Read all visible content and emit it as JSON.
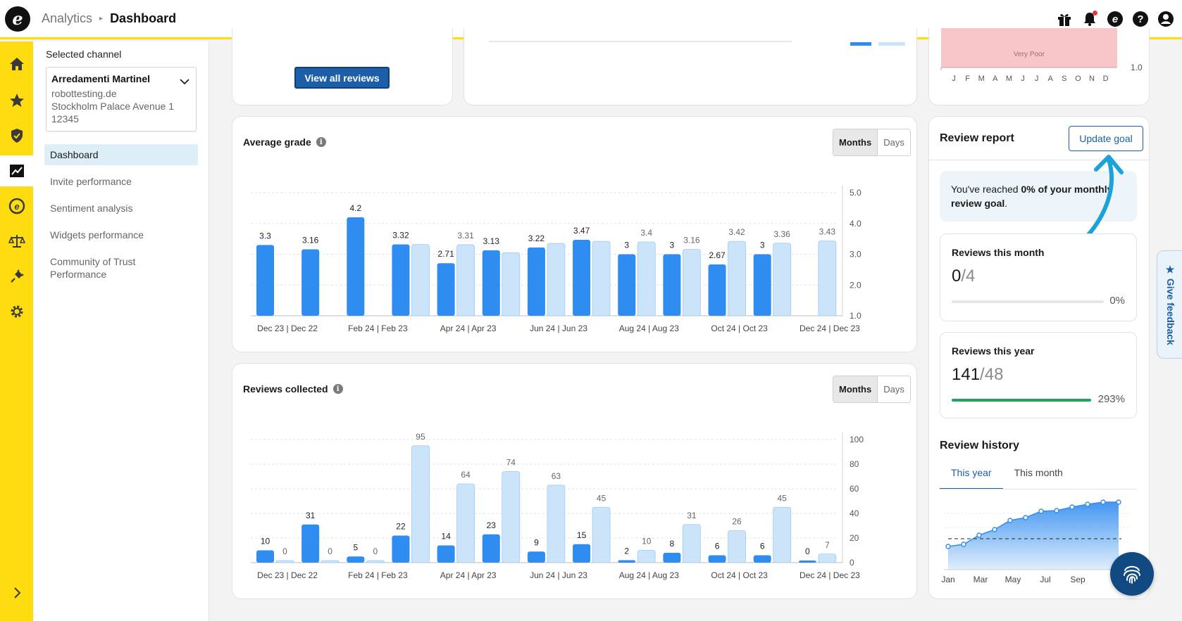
{
  "topbar": {
    "crumb_parent": "Analytics",
    "crumb_current": "Dashboard"
  },
  "rail": {
    "icons": [
      "home-icon",
      "star-icon",
      "shield-icon",
      "analytics-icon",
      "trustedshops-e-icon",
      "scales-icon",
      "plug-icon",
      "gear-icon"
    ],
    "active": "analytics-icon"
  },
  "sidebar": {
    "selected_label": "Selected channel",
    "channel": {
      "name": "Arredamenti Martinel",
      "domain": "robottesting.de",
      "address": "Stockholm Palace Avenue 1",
      "zip": "12345"
    },
    "nav": [
      "Dashboard",
      "Invite performance",
      "Sentiment analysis",
      "Widgets performance",
      "Community of Trust Performance"
    ]
  },
  "top_cards": {
    "view_all_reviews": "View all reviews",
    "very_poor": "Very Poor",
    "y_value": "1.0",
    "months": [
      "J",
      "F",
      "M",
      "A",
      "M",
      "J",
      "J",
      "A",
      "S",
      "O",
      "N",
      "D"
    ]
  },
  "average_grade": {
    "title": "Average grade",
    "toggle": [
      "Months",
      "Days"
    ],
    "chart_data": {
      "type": "bar",
      "ylim": [
        1.0,
        5.0
      ],
      "yticks": [
        "1.0",
        "2.0",
        "3.0",
        "4.0",
        "5.0"
      ],
      "x_labels": [
        "Dec 23 | Dec 22",
        "Feb 24 | Feb 23",
        "Apr 24 | Apr 23",
        "Jun 24 | Jun 23",
        "Aug 24 | Aug 23",
        "Oct 24 | Oct 23",
        "Dec 24 | Dec 23"
      ],
      "current": [
        3.3,
        3.16,
        4.2,
        3.32,
        2.71,
        3.13,
        3.22,
        3.47,
        3,
        3,
        2.67,
        3,
        null
      ],
      "previous": [
        null,
        null,
        null,
        null,
        3.31,
        null,
        null,
        null,
        3.4,
        3.16,
        3.42,
        3.36,
        3.43
      ],
      "previous_unlabeled": [
        null,
        null,
        null,
        3.32,
        null,
        3.05,
        3.35,
        3.42,
        null,
        null,
        null,
        null,
        null
      ],
      "colors": {
        "current": "#2f8cf0",
        "previous": "#cce4fa"
      }
    }
  },
  "reviews_collected": {
    "title": "Reviews collected",
    "toggle": [
      "Months",
      "Days"
    ],
    "chart_data": {
      "type": "bar",
      "ylim": [
        0,
        100
      ],
      "yticks": [
        "0",
        "20",
        "40",
        "60",
        "80",
        "100"
      ],
      "x_labels": [
        "Dec 23 | Dec 22",
        "Feb 24 | Feb 23",
        "Apr 24 | Apr 23",
        "Jun 24 | Jun 23",
        "Aug 24 | Aug 23",
        "Oct 24 | Oct 23",
        "Dec 24 | Dec 23"
      ],
      "current": [
        10,
        31,
        5,
        22,
        14,
        23,
        9,
        15,
        2,
        8,
        6,
        6,
        0
      ],
      "previous": [
        0,
        0,
        0,
        95,
        64,
        74,
        63,
        45,
        10,
        31,
        26,
        45,
        7
      ],
      "colors": {
        "current": "#2f8cf0",
        "previous": "#cce4fa"
      }
    }
  },
  "review_report": {
    "title": "Review report",
    "update_goal": "Update goal",
    "goal_prefix": "You've reached ",
    "goal_bold": "0% of your monthly review goal",
    "goal_suffix": ".",
    "month": {
      "title": "Reviews this month",
      "value": "0",
      "target": "/4",
      "pct": "0%",
      "progress": 0
    },
    "year": {
      "title": "Reviews this year",
      "value": "141",
      "target": "/48",
      "pct": "293%",
      "progress": 1.0
    },
    "history_title": "Review history",
    "tabs": [
      "This year",
      "This month"
    ],
    "history_chart": {
      "type": "area",
      "x_labels": [
        "Jan",
        "Mar",
        "May",
        "Jul",
        "Sep"
      ],
      "colors": {
        "line": "#2f8cf0"
      }
    }
  },
  "feedback": "★ Give feedback"
}
